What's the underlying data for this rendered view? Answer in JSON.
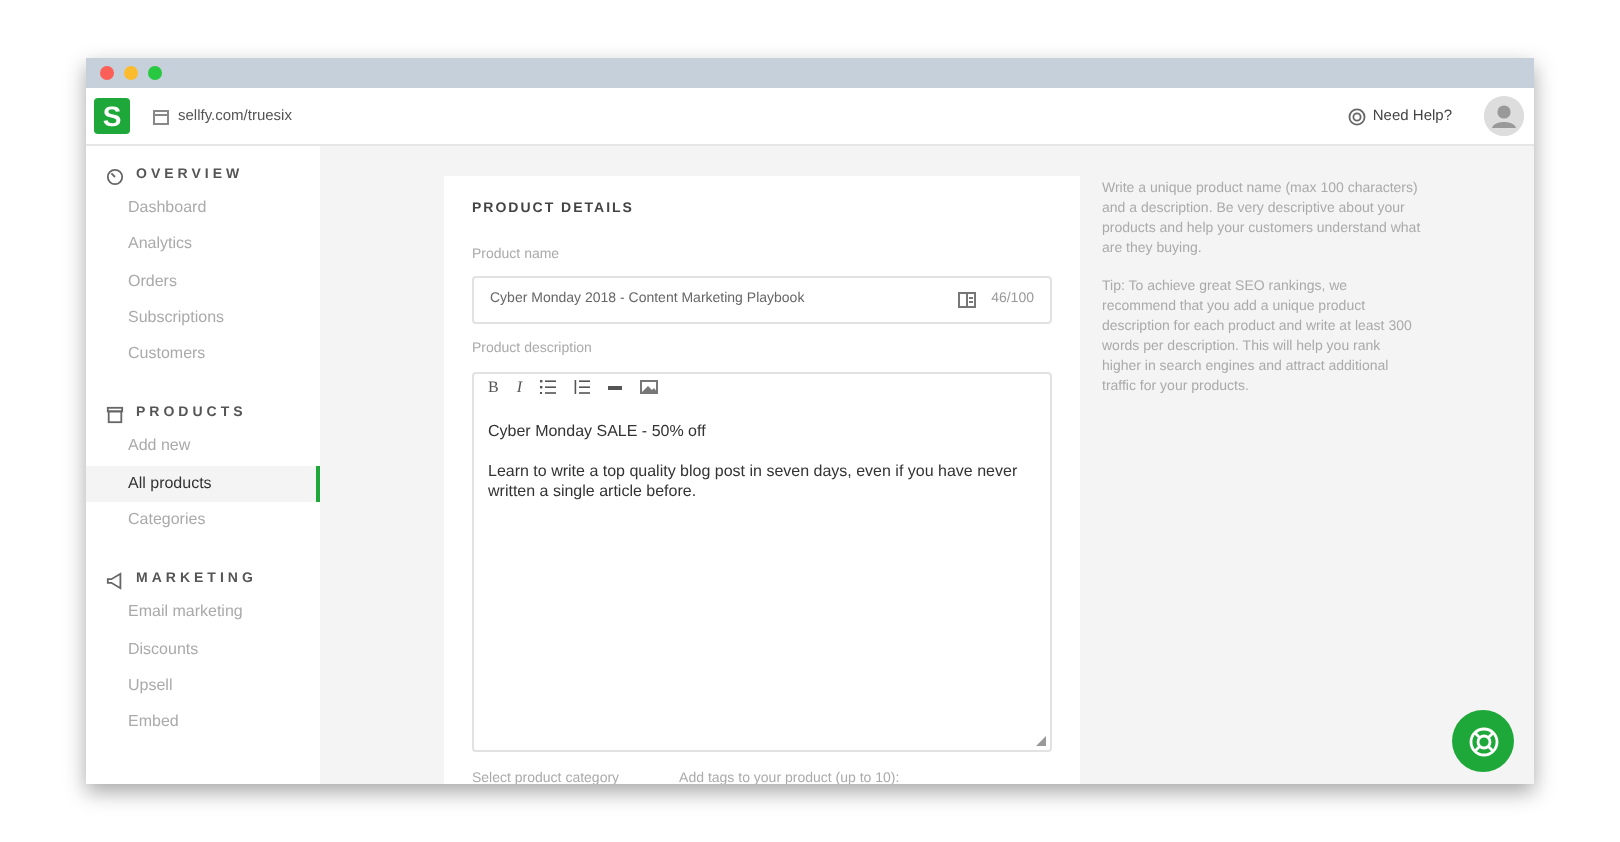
{
  "header": {
    "logo": "S",
    "url": "sellfy.com/truesix",
    "help": "Need Help?"
  },
  "sidebar": [
    {
      "title": "OVERVIEW",
      "kind": "overview",
      "items": [
        {
          "label": "Dashboard",
          "selected": false
        },
        {
          "label": "Analytics",
          "selected": false
        },
        {
          "label": "Orders",
          "selected": false
        },
        {
          "label": "Subscriptions",
          "selected": false
        },
        {
          "label": "Customers",
          "selected": false
        }
      ]
    },
    {
      "title": "PRODUCTS",
      "kind": "products",
      "items": [
        {
          "label": "Add new",
          "selected": false
        },
        {
          "label": "All products",
          "selected": true
        },
        {
          "label": "Categories",
          "selected": false
        }
      ]
    },
    {
      "title": "MARKETING",
      "kind": "marketing",
      "items": [
        {
          "label": "Email marketing",
          "selected": false
        },
        {
          "label": "Discounts",
          "selected": false
        },
        {
          "label": "Upsell",
          "selected": false
        },
        {
          "label": "Embed",
          "selected": false
        }
      ]
    }
  ],
  "card": {
    "title": "PRODUCT DETAILS",
    "name_label": "Product name",
    "name_value": "Cyber Monday 2018 - Content Marketing Playbook",
    "name_count": "46/100",
    "description_label": "Product description",
    "toolbar": [
      "B",
      "I"
    ],
    "description": [
      "Cyber Monday SALE - 50% off",
      "Learn to write a top quality blog post in seven days, even if you have never written a single article before."
    ],
    "category_label": "Select product category",
    "tags_label": "Add tags to your product (up to 10):"
  },
  "help_text": [
    "Write a unique product name (max 100 characters) and a description. Be very descriptive about your products and help your customers understand what are they buying.",
    "Tip: To achieve great SEO rankings, we recommend that you add a unique product description for each product and write at least 300 words per description. This will help you rank higher in search engines and attract additional traffic for your products."
  ]
}
